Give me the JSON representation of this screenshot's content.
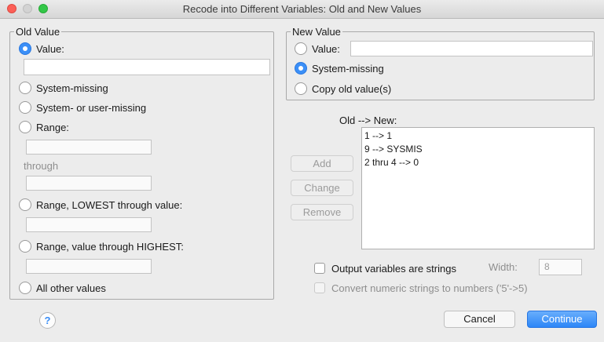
{
  "window": {
    "title": "Recode into Different Variables: Old and New Values"
  },
  "old_value": {
    "legend": "Old Value",
    "value_label": "Value:",
    "value_input": "",
    "system_missing": "System-missing",
    "system_or_user_missing": "System- or user-missing",
    "range": "Range:",
    "through": "through",
    "range_lowest": "Range, LOWEST through value:",
    "range_highest": "Range, value through HIGHEST:",
    "all_other": "All other values",
    "selected": "Value"
  },
  "new_value": {
    "legend": "New Value",
    "value_label": "Value:",
    "system_missing": "System-missing",
    "copy_old": "Copy old value(s)",
    "selected": "System-missing"
  },
  "mapping": {
    "header": "Old --> New:",
    "items": [
      "1 --> 1",
      "9 --> SYSMIS",
      "2 thru 4 --> 0"
    ]
  },
  "buttons": {
    "add": "Add",
    "change": "Change",
    "remove": "Remove",
    "cancel": "Cancel",
    "continue": "Continue",
    "help": "?"
  },
  "options": {
    "output_strings": "Output variables are strings",
    "width_label": "Width:",
    "width_value": "8",
    "convert_numeric": "Convert numeric strings to numbers ('5'->5)"
  },
  "colors": {
    "accent": "#3b8ff7",
    "window_bg": "#ececec"
  },
  "icons": {
    "help": "help-icon",
    "radio_selected": "radio-selected-icon"
  }
}
